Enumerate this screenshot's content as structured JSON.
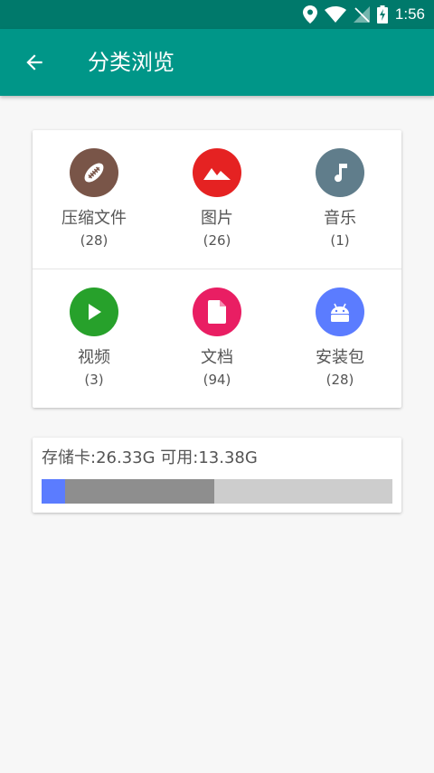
{
  "status_bar": {
    "time": "1:56",
    "icons": [
      "location-icon",
      "wifi-icon",
      "no-signal-icon",
      "battery-charging-icon"
    ]
  },
  "app_bar": {
    "title": "分类浏览",
    "back_icon": "arrow-back-icon"
  },
  "categories": [
    {
      "label": "压缩文件",
      "count": "(28)",
      "icon": "archive-football-icon",
      "color": "#795548"
    },
    {
      "label": "图片",
      "count": "(26)",
      "icon": "image-mountain-icon",
      "color": "#e52222"
    },
    {
      "label": "音乐",
      "count": "(1)",
      "icon": "music-note-icon",
      "color": "#607d8b"
    },
    {
      "label": "视频",
      "count": "(3)",
      "icon": "video-play-icon",
      "color": "#27a12b"
    },
    {
      "label": "文档",
      "count": "(94)",
      "icon": "document-icon",
      "color": "#e91e63"
    },
    {
      "label": "安装包",
      "count": "(28)",
      "icon": "android-icon",
      "color": "#5b7cff"
    }
  ],
  "storage": {
    "label": "存储卡:26.33G 可用:13.38G",
    "segments": [
      {
        "name": "used-highlight",
        "fraction": 0.067,
        "color": "#5b7cff"
      },
      {
        "name": "used-other",
        "fraction": 0.425,
        "color": "#8e8e8e"
      }
    ],
    "track_color": "#cdcdcd"
  },
  "colors": {
    "primary": "#009688",
    "primary_dark": "#00796b",
    "background": "#f7f7f7"
  }
}
